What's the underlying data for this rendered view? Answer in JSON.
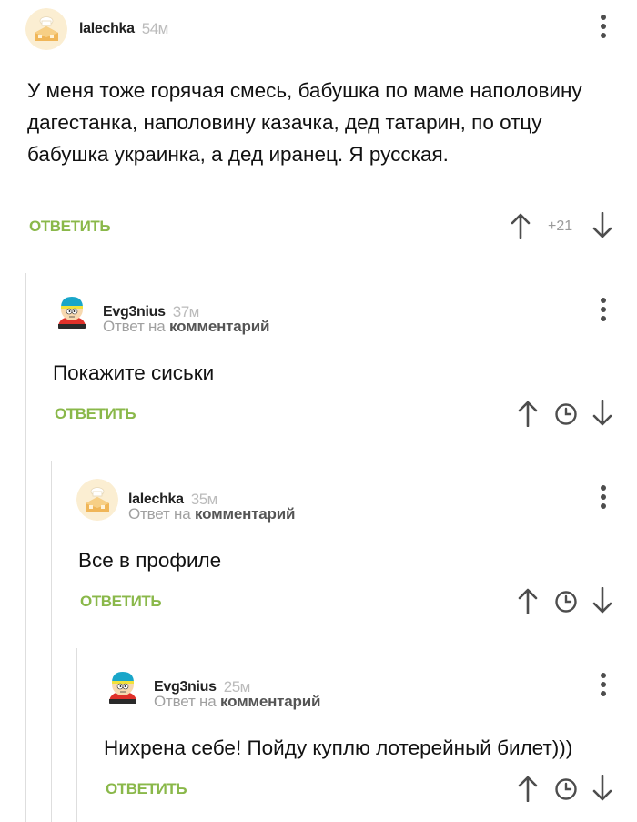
{
  "comments": [
    {
      "author": "lalechka",
      "time": "54м",
      "text": "У меня тоже горячая смесь, бабушка по маме наполовину дагестанка, наполовину казачка, дед татарин, по отцу бабушка украинка, а дед  иранец. Я русская.",
      "reply_label": "ОТВЕТИТЬ",
      "score": "+21"
    },
    {
      "author": "Evg3nius",
      "time": "37м",
      "reply_to_prefix": "Ответ на",
      "reply_to_link": "комментарий",
      "text": "Покажите сиськи",
      "reply_label": "ОТВЕТИТЬ"
    },
    {
      "author": "lalechka",
      "time": "35м",
      "reply_to_prefix": "Ответ на",
      "reply_to_link": "комментарий",
      "text": "Все в профиле",
      "reply_label": "ОТВЕТИТЬ"
    },
    {
      "author": "Evg3nius",
      "time": "25м",
      "reply_to_prefix": "Ответ на",
      "reply_to_link": "комментарий",
      "text": "Нихрена себе! Пойду куплю лотерейный билет)))",
      "reply_label": "ОТВЕТИТЬ"
    }
  ],
  "colors": {
    "reply_green": "#8ab84a",
    "thread_line": "#dedede",
    "icon_gray": "#4d4d4d"
  },
  "icons": [
    "cake-avatar-icon",
    "cartman-avatar-icon",
    "more-vertical-icon",
    "arrow-up-icon",
    "arrow-down-icon",
    "clock-icon"
  ]
}
